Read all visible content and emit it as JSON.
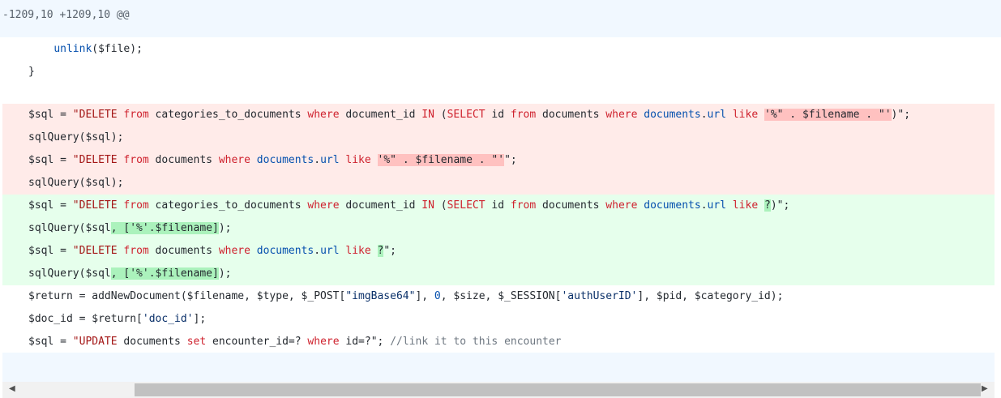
{
  "hunk_header": "-1209,10 +1209,10 @@",
  "lines": [
    {
      "type": "ctx",
      "tokens": [
        {
          "t": "    "
        },
        {
          "t": "unlink",
          "c": "n"
        },
        {
          "t": "($file);"
        }
      ]
    },
    {
      "type": "ctx",
      "tokens": [
        {
          "t": "}"
        }
      ]
    },
    {
      "type": "gap"
    },
    {
      "type": "del",
      "tokens": [
        {
          "t": "$sql = ",
          "c": "f"
        },
        {
          "t": "\"DELETE ",
          "c": "s"
        },
        {
          "t": "from",
          "c": "k"
        },
        {
          "t": " categories_to_documents "
        },
        {
          "t": "where",
          "c": "k"
        },
        {
          "t": " document_id "
        },
        {
          "t": "IN",
          "c": "k"
        },
        {
          "t": " ("
        },
        {
          "t": "SELECT",
          "c": "k"
        },
        {
          "t": " id "
        },
        {
          "t": "from",
          "c": "k"
        },
        {
          "t": " documents "
        },
        {
          "t": "where",
          "c": "k"
        },
        {
          "t": " "
        },
        {
          "t": "documents",
          "c": "n"
        },
        {
          "t": "."
        },
        {
          "t": "url",
          "c": "n"
        },
        {
          "t": " "
        },
        {
          "t": "like",
          "c": "k"
        },
        {
          "t": " "
        },
        {
          "t": "'%\" . $filename . \"'",
          "h": "del"
        },
        {
          "t": ")\";"
        }
      ]
    },
    {
      "type": "del",
      "tokens": [
        {
          "t": "sqlQuery($sql);"
        }
      ]
    },
    {
      "type": "del",
      "tokens": [
        {
          "t": "$sql = "
        },
        {
          "t": "\"DELETE ",
          "c": "s"
        },
        {
          "t": "from",
          "c": "k"
        },
        {
          "t": " documents "
        },
        {
          "t": "where",
          "c": "k"
        },
        {
          "t": " "
        },
        {
          "t": "documents",
          "c": "n"
        },
        {
          "t": "."
        },
        {
          "t": "url",
          "c": "n"
        },
        {
          "t": " "
        },
        {
          "t": "like",
          "c": "k"
        },
        {
          "t": " "
        },
        {
          "t": "'%\" . $filename . \"'",
          "h": "del"
        },
        {
          "t": "\";"
        }
      ]
    },
    {
      "type": "del",
      "tokens": [
        {
          "t": "sqlQuery($sql);"
        }
      ]
    },
    {
      "type": "add",
      "tokens": [
        {
          "t": "$sql = "
        },
        {
          "t": "\"DELETE ",
          "c": "s"
        },
        {
          "t": "from",
          "c": "k"
        },
        {
          "t": " categories_to_documents "
        },
        {
          "t": "where",
          "c": "k"
        },
        {
          "t": " document_id "
        },
        {
          "t": "IN",
          "c": "k"
        },
        {
          "t": " ("
        },
        {
          "t": "SELECT",
          "c": "k"
        },
        {
          "t": " id "
        },
        {
          "t": "from",
          "c": "k"
        },
        {
          "t": " documents "
        },
        {
          "t": "where",
          "c": "k"
        },
        {
          "t": " "
        },
        {
          "t": "documents",
          "c": "n"
        },
        {
          "t": "."
        },
        {
          "t": "url",
          "c": "n"
        },
        {
          "t": " "
        },
        {
          "t": "like",
          "c": "k"
        },
        {
          "t": " "
        },
        {
          "t": "?",
          "h": "add"
        },
        {
          "t": ")\";"
        }
      ]
    },
    {
      "type": "add",
      "tokens": [
        {
          "t": "sqlQuery($sql"
        },
        {
          "t": ", ['%'.$filename]",
          "h": "add"
        },
        {
          "t": ");"
        }
      ]
    },
    {
      "type": "add",
      "tokens": [
        {
          "t": "$sql = "
        },
        {
          "t": "\"DELETE ",
          "c": "s"
        },
        {
          "t": "from",
          "c": "k"
        },
        {
          "t": " documents "
        },
        {
          "t": "where",
          "c": "k"
        },
        {
          "t": " "
        },
        {
          "t": "documents",
          "c": "n"
        },
        {
          "t": "."
        },
        {
          "t": "url",
          "c": "n"
        },
        {
          "t": " "
        },
        {
          "t": "like",
          "c": "k"
        },
        {
          "t": " "
        },
        {
          "t": "?",
          "h": "add"
        },
        {
          "t": "\";"
        }
      ]
    },
    {
      "type": "add",
      "tokens": [
        {
          "t": "sqlQuery($sql"
        },
        {
          "t": ", ['%'.$filename]",
          "h": "add"
        },
        {
          "t": ");"
        }
      ]
    },
    {
      "type": "ctx",
      "tokens": [
        {
          "t": "$return = addNewDocument($filename, $type, $_POST["
        },
        {
          "t": "\"imgBase64\"",
          "c": "str"
        },
        {
          "t": "], "
        },
        {
          "t": "0",
          "c": "n"
        },
        {
          "t": ", $size, $_SESSION["
        },
        {
          "t": "'authUserID'",
          "c": "str"
        },
        {
          "t": "], $pid, $category_id);"
        }
      ]
    },
    {
      "type": "ctx",
      "tokens": [
        {
          "t": "$doc_id = $return["
        },
        {
          "t": "'doc_id'",
          "c": "str"
        },
        {
          "t": "];"
        }
      ]
    },
    {
      "type": "ctx",
      "tokens": [
        {
          "t": "$sql = "
        },
        {
          "t": "\"UPDATE ",
          "c": "s"
        },
        {
          "t": "documents "
        },
        {
          "t": "set",
          "c": "k"
        },
        {
          "t": " encounter_id=? "
        },
        {
          "t": "where",
          "c": "k"
        },
        {
          "t": " id=?\"; "
        },
        {
          "t": "//link it to this encounter",
          "c": "c"
        }
      ]
    }
  ],
  "colors": {
    "deleted_bg": "#ffebe9",
    "added_bg": "#e6ffec",
    "hunk_bg": "#f1f8ff"
  },
  "scrollbar": {
    "left_arrow": "◀",
    "right_arrow": "▶"
  }
}
